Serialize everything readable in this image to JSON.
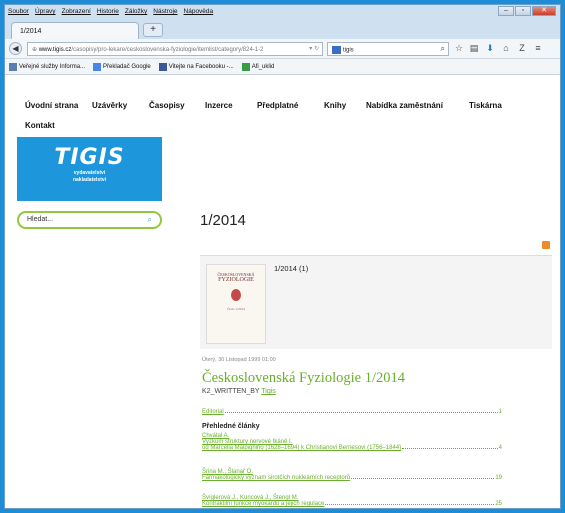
{
  "menubar": {
    "items": [
      "Soubor",
      "Úpravy",
      "Zobrazení",
      "Historie",
      "Záložky",
      "Nástroje",
      "Nápověda"
    ]
  },
  "tab": {
    "title": "1/2014",
    "new_tab": "+"
  },
  "nav": {
    "url_domain": "www.tigis.cz",
    "url_path": "/casopisy/pro-lekare/ceskoslovenska-fyziologie/itemlist/category/824-1-2",
    "search_value": "tigis"
  },
  "bookmarks": [
    {
      "label": "Veřejné služby Informa...",
      "icon": "bookmark-icon",
      "color": "#5b7fb0"
    },
    {
      "label": "Překladač Google",
      "icon": "translate-icon",
      "color": "#4a86e8"
    },
    {
      "label": "Vitejte na Facebooku -...",
      "icon": "facebook-icon",
      "color": "#3b5998"
    },
    {
      "label": "Afi_uklid",
      "icon": "document-icon",
      "color": "#3a9d45"
    }
  ],
  "mainnav": [
    "Úvodní strana",
    "Uzávěrky",
    "Časopisy",
    "Inzerce",
    "Předplatné",
    "Knihy",
    "Nabídka zaměstnání",
    "Tiskárna",
    "Kontakt"
  ],
  "logo": {
    "name": "TIGIS",
    "line1": "vydavatelství",
    "line2": "nakladatelství"
  },
  "search": {
    "placeholder": "Hledat..."
  },
  "page_title": "1/2014",
  "category": {
    "label": "1/2014 (1)",
    "thumb_top": "ČESKOSLOVENSKÁ",
    "thumb_main": "FYZIOLOGIE",
    "thumb_bottom": "Číslo 1/2014"
  },
  "article": {
    "date": "Úterý, 30 Listopad 1999 01:00",
    "title": "Československá Fyziologie 1/2014",
    "written_by": "K2_WRITTEN_BY",
    "author": "Tigis"
  },
  "toc": {
    "editorial": {
      "text": "Editorial",
      "page": "1"
    },
    "section": "Přehledné články",
    "items": [
      {
        "authors": "Chvátal A.",
        "title1": "Výzkum struktury nervové tkáně I.",
        "title2": "od Marcella Malpighiho (1628–1694) k Christianovi Bernesovi (1756–1844)",
        "page": "4"
      },
      {
        "authors": "Šrina M., Šlanař O.",
        "title1": "Farmakologický význam sirotčích nukleárních receptorů",
        "title2": "",
        "page": "19"
      },
      {
        "authors": "Švíglerová J., Kuncová J., Štengl M.",
        "title1": "Kontraktilní funkce myokardu a jejich regulace",
        "title2": "",
        "page": "25"
      }
    ]
  },
  "colors": {
    "accent_green": "#6aaf2c",
    "logo_blue": "#1e96dc",
    "frame_blue": "#1e8cd6"
  }
}
